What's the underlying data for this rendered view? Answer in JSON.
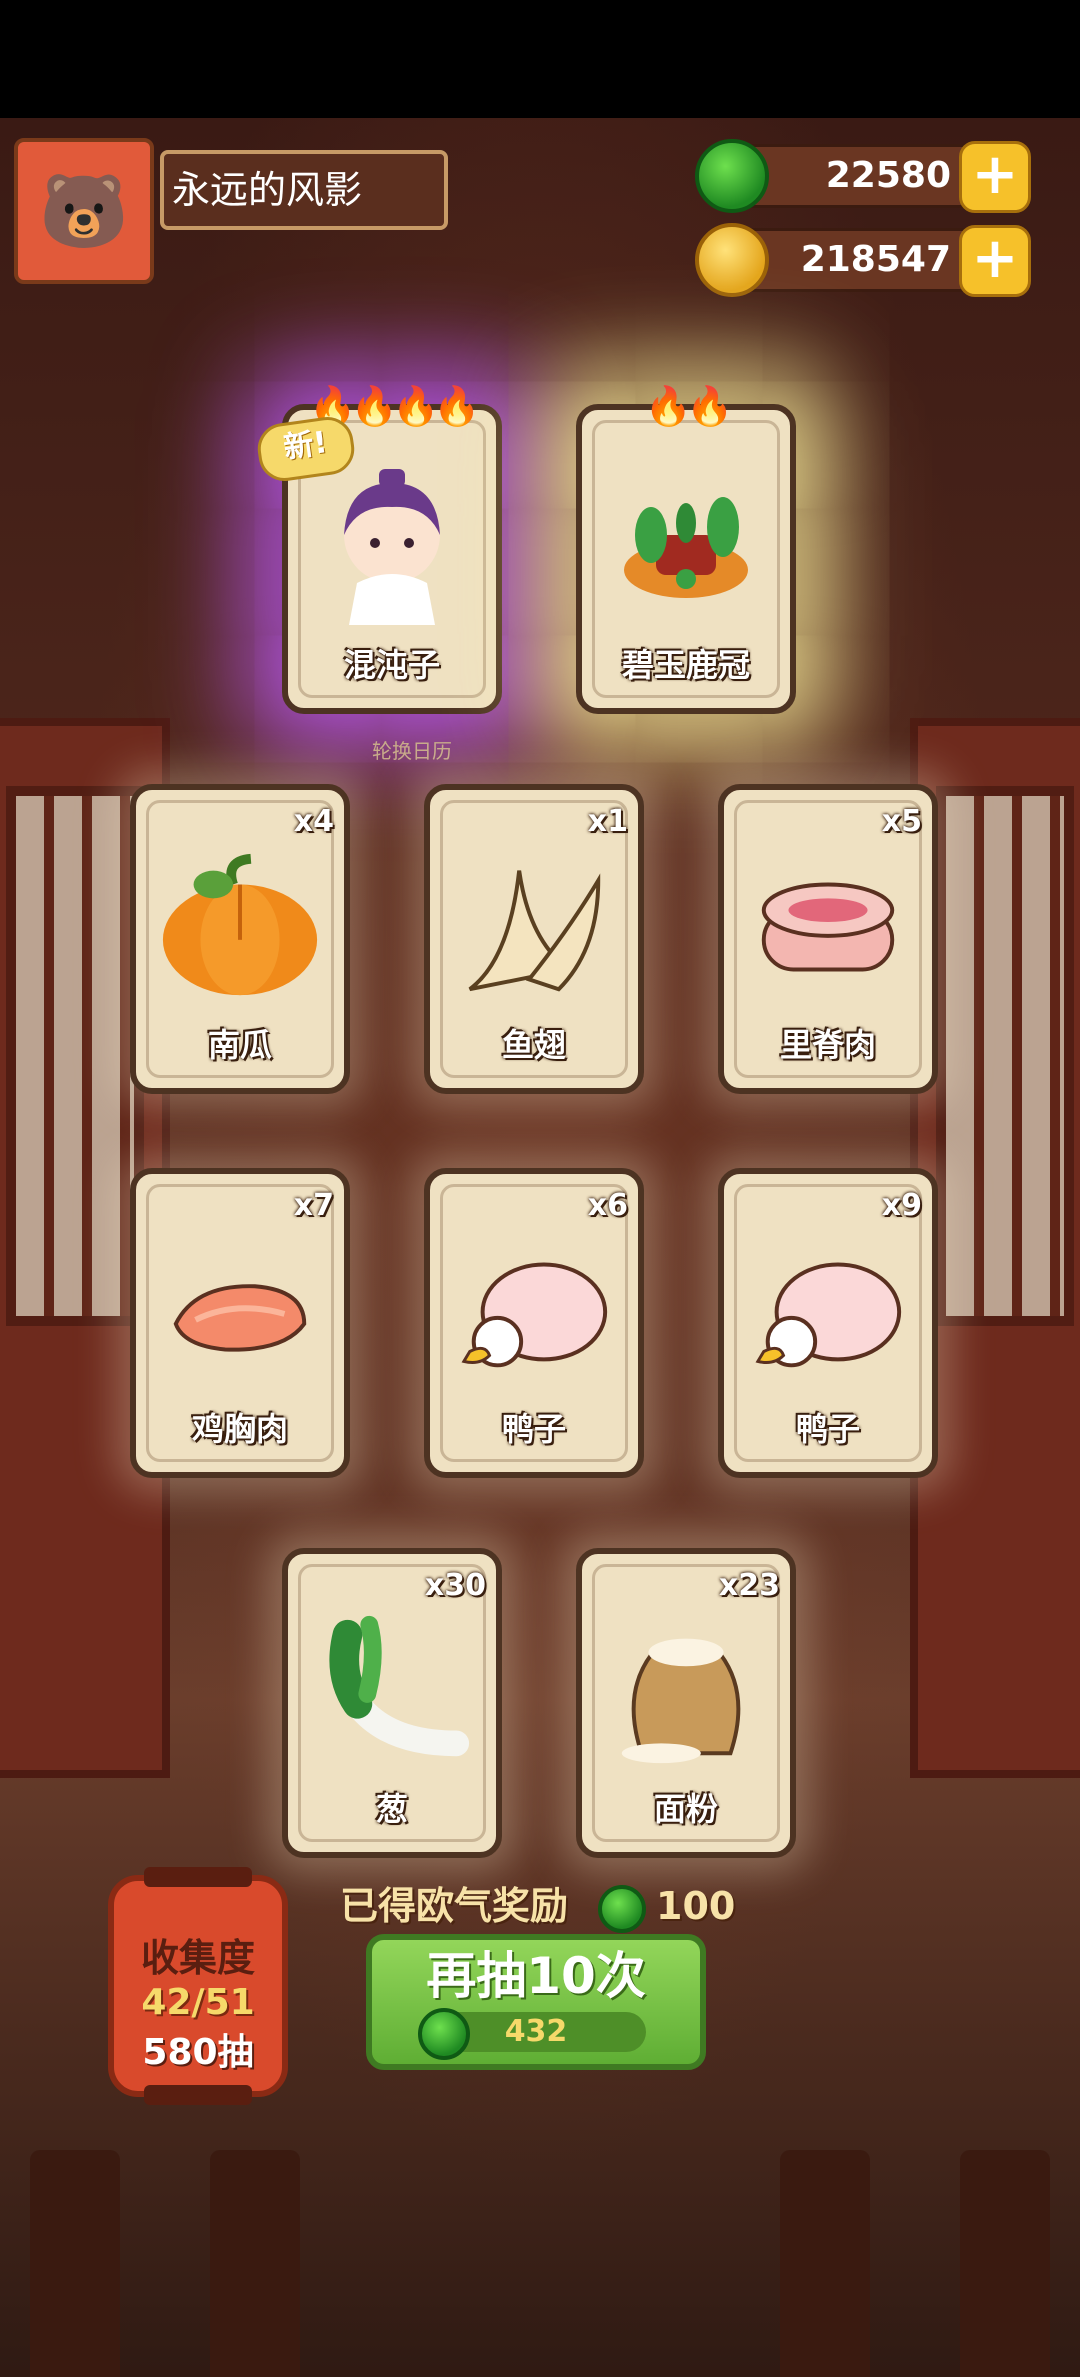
{
  "player": {
    "name": "永远的风影"
  },
  "currencies": {
    "jade": "22580",
    "coins": "218547"
  },
  "featured": [
    {
      "name": "混沌子",
      "flames": "🔥🔥🔥🔥",
      "tag": "新!",
      "rarity": "epic"
    },
    {
      "name": "碧玉鹿冠",
      "flames": "🔥🔥",
      "rarity": "legend"
    }
  ],
  "ribbon_text": "轮换日历",
  "cards": [
    {
      "name": "南瓜",
      "count": "x4",
      "icon": "pumpkin-icon"
    },
    {
      "name": "鱼翅",
      "count": "x1",
      "icon": "shark-fin-icon"
    },
    {
      "name": "里脊肉",
      "count": "x5",
      "icon": "tenderloin-icon"
    },
    {
      "name": "鸡胸肉",
      "count": "x7",
      "icon": "chicken-breast-icon"
    },
    {
      "name": "鸭子",
      "count": "x6",
      "icon": "duck-icon"
    },
    {
      "name": "鸭子",
      "count": "x9",
      "icon": "duck-icon"
    },
    {
      "name": "葱",
      "count": "x30",
      "icon": "scallion-icon"
    },
    {
      "name": "面粉",
      "count": "x23",
      "icon": "flour-icon"
    }
  ],
  "reward": {
    "label": "已得欧气奖励",
    "value": "100"
  },
  "collection": {
    "label": "收集度",
    "progress": "42/51",
    "draws": "580抽"
  },
  "draw_button": {
    "label": "再抽10次",
    "cost": "432"
  },
  "colors": {
    "jade": "#2f9a2a",
    "coin": "#e4a51b",
    "button": "#6cbf3c",
    "epic_glow": "#be5aff"
  }
}
